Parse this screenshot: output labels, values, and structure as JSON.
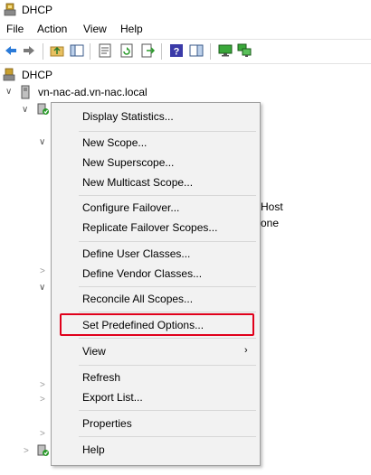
{
  "window": {
    "title": "DHCP"
  },
  "menubar": {
    "items": [
      "File",
      "Action",
      "View",
      "Help"
    ]
  },
  "toolbar": {
    "buttons": [
      "back-arrow-icon",
      "forward-arrow-icon",
      "folder-up-icon",
      "console-tree-icon",
      "properties-icon",
      "refresh-icon",
      "export-list-icon",
      "help-icon",
      "show-hide-action-pane-icon",
      "monitor-green-icon",
      "monitor-network-icon"
    ]
  },
  "tree": {
    "root_label": "DHCP",
    "server_label": "vn-nac-ad.vn-nac.local"
  },
  "background_text": {
    "host": "Host",
    "one": "one"
  },
  "context_menu": {
    "items": [
      {
        "label": "Display Statistics..."
      },
      {
        "label": "New Scope..."
      },
      {
        "label": "New Superscope..."
      },
      {
        "label": "New Multicast Scope..."
      },
      {
        "label": "Configure Failover..."
      },
      {
        "label": "Replicate Failover Scopes..."
      },
      {
        "label": "Define User Classes..."
      },
      {
        "label": "Define Vendor Classes..."
      },
      {
        "label": "Reconcile All Scopes..."
      },
      {
        "label": "Set Predefined Options..."
      },
      {
        "label": "View"
      },
      {
        "label": "Refresh"
      },
      {
        "label": "Export List..."
      },
      {
        "label": "Properties"
      },
      {
        "label": "Help"
      }
    ],
    "highlighted_item": "Set Predefined Options...",
    "highlight_color": "#e0001b"
  }
}
